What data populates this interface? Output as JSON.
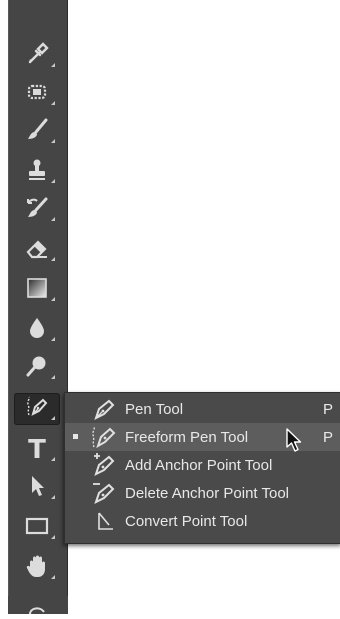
{
  "toolbar": {
    "tools": [
      {
        "icon": "eyedropper-icon"
      },
      {
        "icon": "spot-healing-icon"
      },
      {
        "icon": "brush-icon"
      },
      {
        "icon": "clone-stamp-icon"
      },
      {
        "icon": "history-brush-icon"
      },
      {
        "icon": "eraser-icon"
      },
      {
        "icon": "gradient-icon"
      },
      {
        "icon": "blur-drop-icon"
      },
      {
        "icon": "dodge-icon"
      },
      {
        "icon": "pen-icon",
        "active": true
      },
      {
        "icon": "type-icon",
        "text": "T"
      },
      {
        "icon": "path-selection-arrow-icon"
      },
      {
        "icon": "rectangle-icon"
      },
      {
        "icon": "hand-icon"
      }
    ]
  },
  "flyout": {
    "items": [
      {
        "label": "Pen Tool",
        "shortcut": "P",
        "selected": false
      },
      {
        "label": "Freeform Pen Tool",
        "shortcut": "P",
        "selected": true
      },
      {
        "label": "Add Anchor Point Tool",
        "shortcut": "",
        "selected": false
      },
      {
        "label": "Delete Anchor Point Tool",
        "shortcut": "",
        "selected": false
      },
      {
        "label": "Convert Point Tool",
        "shortcut": "",
        "selected": false
      }
    ]
  },
  "colors": {
    "toolbar_bg": "#454545",
    "menu_bg": "#4a4a4a",
    "menu_hover": "#5d5d5d",
    "icon": "#dcdcdc"
  }
}
